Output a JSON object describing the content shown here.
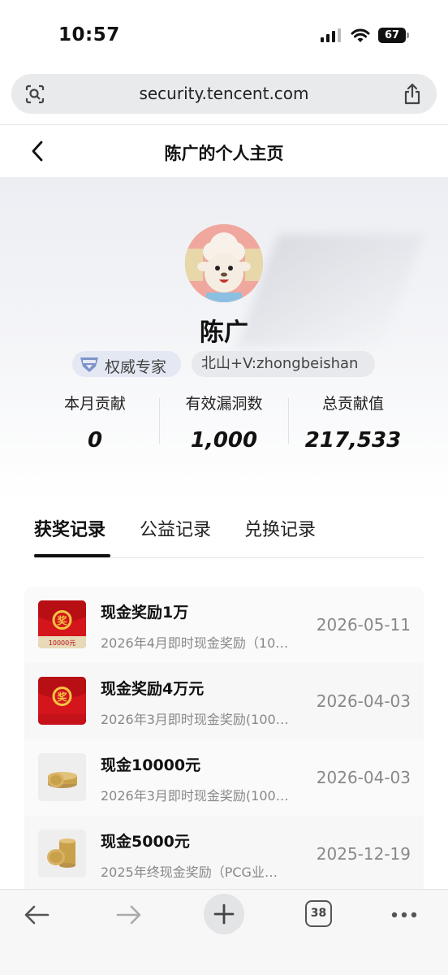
{
  "status_bar": {
    "time": "10:57",
    "battery": "67"
  },
  "browser": {
    "url": "security.tencent.com",
    "tab_count": "38"
  },
  "nav": {
    "title": "陈广的个人主页"
  },
  "profile": {
    "name": "陈广",
    "badge_label": "权威专家",
    "contact": "北山+V:zhongbeishan",
    "stats": [
      {
        "label": "本月贡献",
        "value": "0"
      },
      {
        "label": "有效漏洞数",
        "value": "1,000"
      },
      {
        "label": "总贡献值",
        "value": "217,533"
      }
    ]
  },
  "tabs": [
    {
      "label": "获奖记录",
      "active": true
    },
    {
      "label": "公益记录",
      "active": false
    },
    {
      "label": "兑换记录",
      "active": false
    }
  ],
  "records": [
    {
      "title": "现金奖励1万",
      "subtitle": "2026年4月即时现金奖励（10…",
      "date": "2026-05-11",
      "thumb": "red-envelope",
      "thumb_caption": "10000元"
    },
    {
      "title": "现金奖励4万元",
      "subtitle": "2026年3月即时现金奖励(100…",
      "date": "2026-04-03",
      "thumb": "red-envelope",
      "thumb_caption": ""
    },
    {
      "title": "现金10000元",
      "subtitle": "2026年3月即时现金奖励(100…",
      "date": "2026-04-03",
      "thumb": "gold-coins",
      "thumb_caption": ""
    },
    {
      "title": "现金5000元",
      "subtitle": "2025年终现金奖励（PCG业…",
      "date": "2025-12-19",
      "thumb": "gold-coins",
      "thumb_caption": ""
    }
  ],
  "colors": {
    "accent": "#111111",
    "badge_bg": "#e4e8f3",
    "envelope_red": "#d4151c",
    "coin_gold": "#c9a14a"
  }
}
